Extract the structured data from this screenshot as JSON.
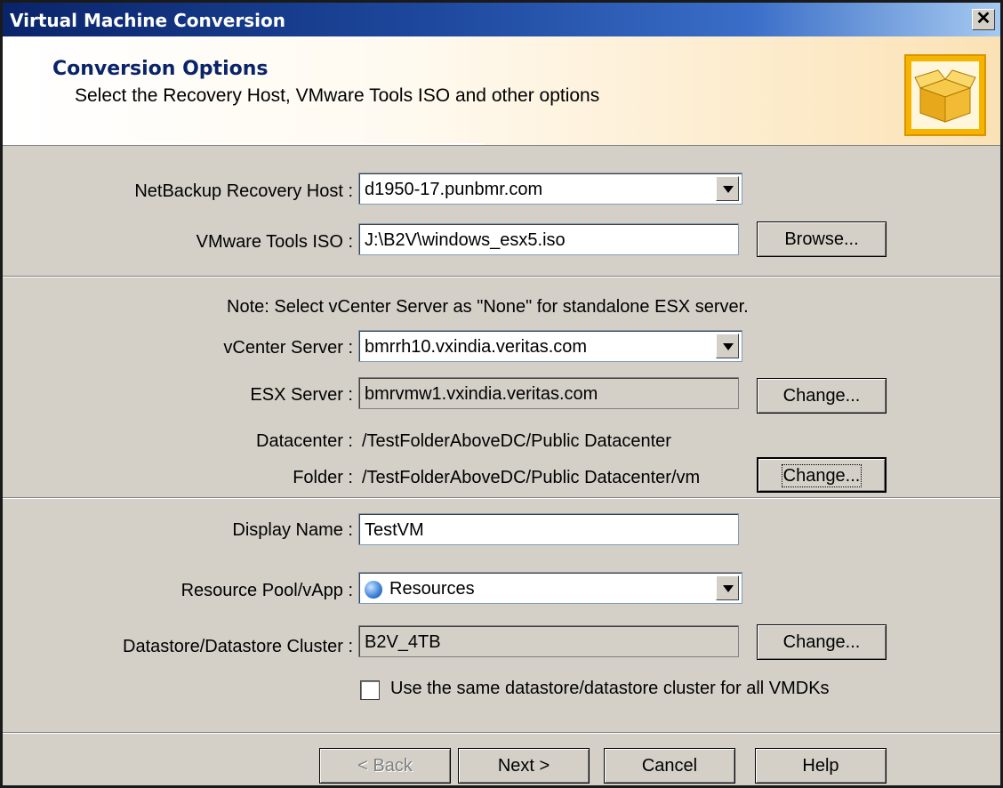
{
  "window": {
    "title": "Virtual Machine Conversion",
    "close_label": "✕"
  },
  "banner": {
    "title": "Conversion Options",
    "subtitle": "Select the Recovery Host, VMware Tools ISO and other options",
    "icon": "package-box-icon"
  },
  "fields": {
    "recovery_host": {
      "label": "NetBackup Recovery Host :",
      "value": "d1950-17.punbmr.com"
    },
    "tools_iso": {
      "label": "VMware Tools ISO :",
      "value": "J:\\B2V\\windows_esx5.iso"
    },
    "note": "Note: Select vCenter Server as \"None\" for standalone ESX server.",
    "vcenter": {
      "label": "vCenter Server :",
      "value": "bmrrh10.vxindia.veritas.com"
    },
    "esx": {
      "label": "ESX Server :",
      "value": "bmrvmw1.vxindia.veritas.com"
    },
    "datacenter": {
      "label": "Datacenter :",
      "value": "/TestFolderAboveDC/Public Datacenter"
    },
    "folder": {
      "label": "Folder :",
      "value": "/TestFolderAboveDC/Public Datacenter/vm"
    },
    "display_name": {
      "label": "Display Name :",
      "value": "TestVM"
    },
    "resource_pool": {
      "label": "Resource Pool/vApp :",
      "value": "Resources"
    },
    "datastore": {
      "label": "Datastore/Datastore Cluster :",
      "value": "B2V_4TB"
    },
    "same_datastore": {
      "label": "Use the same datastore/datastore cluster for all VMDKs",
      "checked": false
    }
  },
  "buttons": {
    "browse": "Browse...",
    "change_esx": "Change...",
    "change_folder": "Change...",
    "change_datastore": "Change...",
    "back": "< Back",
    "next": "Next >",
    "cancel": "Cancel",
    "help": "Help"
  }
}
